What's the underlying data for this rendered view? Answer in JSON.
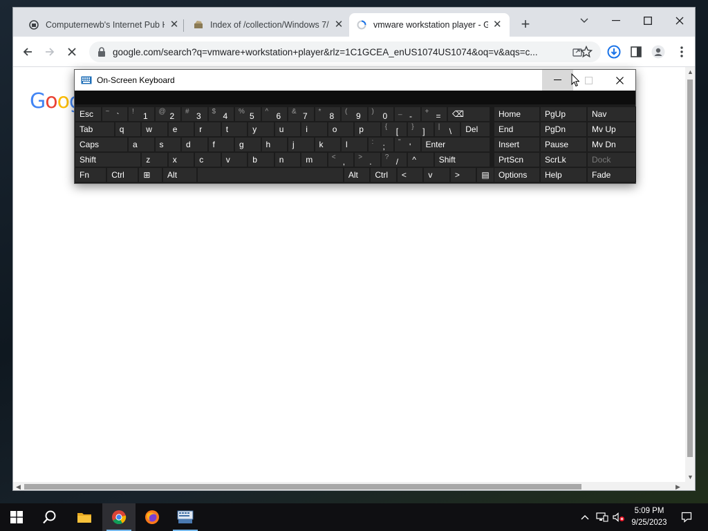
{
  "browser": {
    "tabs": [
      {
        "title": "Computernewb's Internet Pub H",
        "favicon": "pub-favicon"
      },
      {
        "title": "Index of /collection/Windows 7/",
        "favicon": "archive-favicon"
      },
      {
        "title": "vmware workstation player - Go",
        "favicon": "loading-spinner"
      }
    ],
    "url": "google.com/search?q=vmware+workstation+player&rlz=1C1GCEA_enUS1074US1074&oq=v&aqs=c...",
    "page_logo": "Goog"
  },
  "osk": {
    "title": "On-Screen Keyboard",
    "rows": [
      [
        {
          "label": "Esc"
        },
        {
          "shift": "~",
          "main": "`"
        },
        {
          "shift": "!",
          "main": "1"
        },
        {
          "shift": "@",
          "main": "2"
        },
        {
          "shift": "#",
          "main": "3"
        },
        {
          "shift": "$",
          "main": "4"
        },
        {
          "shift": "%",
          "main": "5"
        },
        {
          "shift": "^",
          "main": "6"
        },
        {
          "shift": "&",
          "main": "7"
        },
        {
          "shift": "*",
          "main": "8"
        },
        {
          "shift": "(",
          "main": "9"
        },
        {
          "shift": ")",
          "main": "0"
        },
        {
          "shift": "_",
          "main": "-"
        },
        {
          "shift": "+",
          "main": "="
        },
        {
          "label": "⌫"
        }
      ],
      [
        {
          "label": "Tab"
        },
        {
          "label": "q"
        },
        {
          "label": "w"
        },
        {
          "label": "e"
        },
        {
          "label": "r"
        },
        {
          "label": "t"
        },
        {
          "label": "y"
        },
        {
          "label": "u"
        },
        {
          "label": "i"
        },
        {
          "label": "o"
        },
        {
          "label": "p"
        },
        {
          "shift": "{",
          "main": "["
        },
        {
          "shift": "}",
          "main": "]"
        },
        {
          "shift": "|",
          "main": "\\"
        },
        {
          "label": "Del"
        }
      ],
      [
        {
          "label": "Caps"
        },
        {
          "label": "a"
        },
        {
          "label": "s"
        },
        {
          "label": "d"
        },
        {
          "label": "f"
        },
        {
          "label": "g"
        },
        {
          "label": "h"
        },
        {
          "label": "j"
        },
        {
          "label": "k"
        },
        {
          "label": "l"
        },
        {
          "shift": ":",
          "main": ";"
        },
        {
          "shift": "\"",
          "main": "'"
        },
        {
          "label": "Enter"
        }
      ],
      [
        {
          "label": "Shift"
        },
        {
          "label": "z"
        },
        {
          "label": "x"
        },
        {
          "label": "c"
        },
        {
          "label": "v"
        },
        {
          "label": "b"
        },
        {
          "label": "n"
        },
        {
          "label": "m"
        },
        {
          "shift": "<",
          "main": ","
        },
        {
          "shift": ">",
          "main": "."
        },
        {
          "shift": "?",
          "main": "/"
        },
        {
          "label": "^"
        },
        {
          "label": "Shift"
        }
      ],
      [
        {
          "label": "Fn"
        },
        {
          "label": "Ctrl"
        },
        {
          "label": "⊞"
        },
        {
          "label": "Alt"
        },
        {
          "label": ""
        },
        {
          "label": "Alt"
        },
        {
          "label": "Ctrl"
        },
        {
          "label": "<"
        },
        {
          "label": "v"
        },
        {
          "label": ">"
        },
        {
          "label": "▤"
        }
      ]
    ],
    "nav_keys": [
      [
        "Home",
        "PgUp",
        "Nav"
      ],
      [
        "End",
        "PgDn",
        "Mv Up"
      ],
      [
        "Insert",
        "Pause",
        "Mv Dn"
      ],
      [
        "PrtScn",
        "ScrLk",
        "Dock"
      ],
      [
        "Options",
        "Help",
        "Fade"
      ]
    ]
  },
  "taskbar": {
    "apps": [
      "start-icon",
      "search-icon",
      "file-explorer-icon",
      "chrome-icon",
      "firefox-icon",
      "osk-app-icon"
    ],
    "clock_time": "5:09 PM",
    "clock_date": "9/25/2023"
  }
}
